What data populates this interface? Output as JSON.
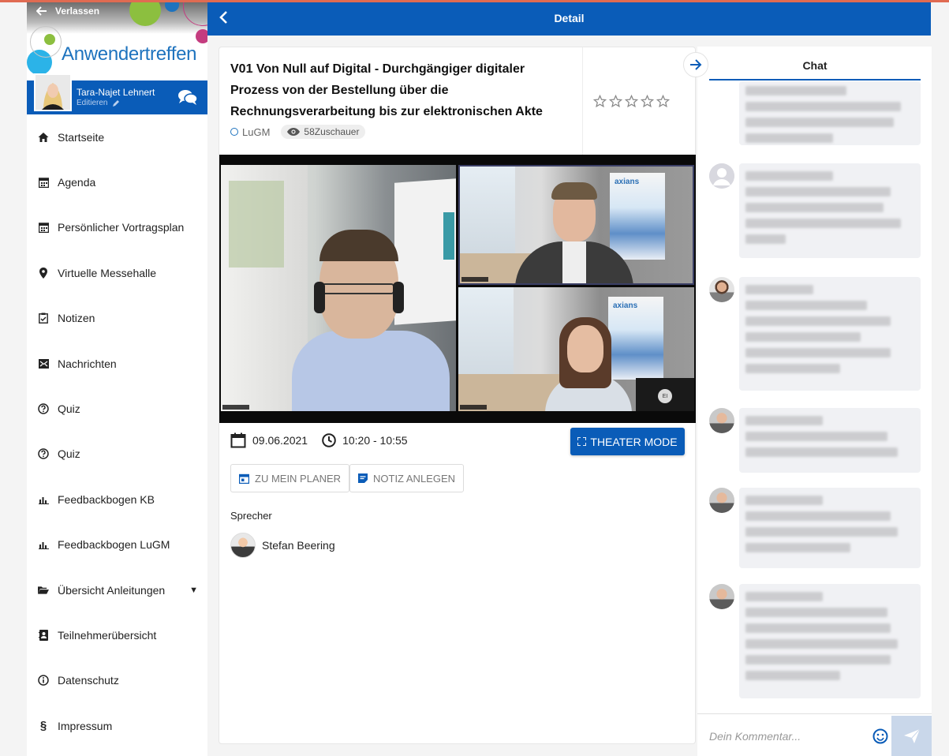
{
  "sidebar": {
    "back_label": "Verlassen",
    "brand": "Anwendertreffen",
    "user": {
      "name": "Tara-Najet Lehnert",
      "edit_label": "Editieren"
    },
    "items": [
      {
        "label": "Startseite",
        "icon": "home-icon"
      },
      {
        "label": "Agenda",
        "icon": "calendar-icon"
      },
      {
        "label": "Persönlicher Vortragsplan",
        "icon": "calendar-icon"
      },
      {
        "label": "Virtuelle Messehalle",
        "icon": "location-pin-icon"
      },
      {
        "label": "Notizen",
        "icon": "clipboard-check-icon"
      },
      {
        "label": "Nachrichten",
        "icon": "envelope-icon"
      },
      {
        "label": "Quiz",
        "icon": "question-circle-icon"
      },
      {
        "label": "Quiz",
        "icon": "question-circle-icon"
      },
      {
        "label": "Feedbackbogen KB",
        "icon": "bar-chart-icon"
      },
      {
        "label": "Feedbackbogen LuGM",
        "icon": "bar-chart-icon"
      },
      {
        "label": "Übersicht Anleitungen",
        "icon": "folder-open-icon",
        "has_submenu": true
      },
      {
        "label": "Teilnehmerübersicht",
        "icon": "contact-book-icon"
      },
      {
        "label": "Datenschutz",
        "icon": "info-circle-icon"
      },
      {
        "label": "Impressum",
        "icon": "section-sign-icon"
      }
    ]
  },
  "header": {
    "title": "Detail"
  },
  "session": {
    "title": "V01 Von Null auf Digital - Durchgängiger digitaler Prozess von der Bestellung über die Rechnungsverarbeitung bis zur elektronischen Akte",
    "track": "LuGM",
    "viewers": "58Zuschauer",
    "rating_max": 5,
    "rating": 0,
    "date": "09.06.2021",
    "time": "10:20 - 10:55",
    "theater_label": "THEATER MODE",
    "planner_label": "ZU MEIN PLANER",
    "note_label": "NOTIZ ANLEGEN",
    "speakers_heading": "Sprecher",
    "speakers": [
      {
        "name": "Stefan Beering"
      }
    ],
    "video": {
      "poster_brand": "axians",
      "participant_initials": "EI"
    }
  },
  "chat": {
    "tab_label": "Chat",
    "input_placeholder": "Dein Kommentar..."
  },
  "colors": {
    "primary": "#0a5cb8",
    "bubble": "#f0f1f4",
    "accent_line": "#e06b52"
  }
}
